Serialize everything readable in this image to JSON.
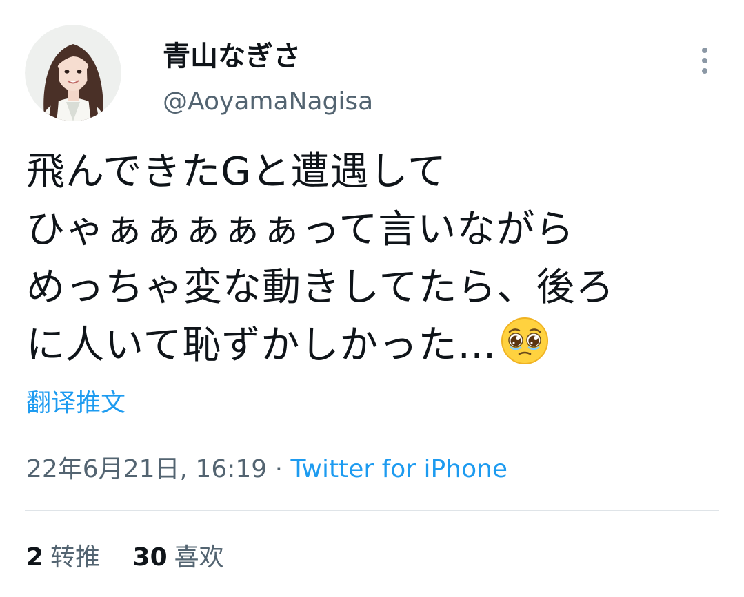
{
  "user": {
    "display_name": "青山なぎさ",
    "handle": "@AoyamaNagisa"
  },
  "tweet": {
    "lines": [
      "飛んできたGと遭遇して",
      "ひゃぁぁぁぁぁって言いながら",
      "めっちゃ変な動きしてたら、後ろ",
      "に人いて恥ずかしかった…"
    ],
    "emoji": "pleading-face-emoji"
  },
  "translate_label": "翻译推文",
  "meta": {
    "timestamp": "22年6月21日, 16:19",
    "separator": "·",
    "source": "Twitter for iPhone"
  },
  "stats": {
    "retweets_count": "2",
    "retweets_label": "转推",
    "likes_count": "30",
    "likes_label": "喜欢"
  },
  "colors": {
    "text": "#0f1419",
    "secondary": "#536471",
    "accent": "#1d9bf0",
    "divider": "#dfe4e8"
  },
  "icons": {
    "more": "more-vertical-icon"
  }
}
